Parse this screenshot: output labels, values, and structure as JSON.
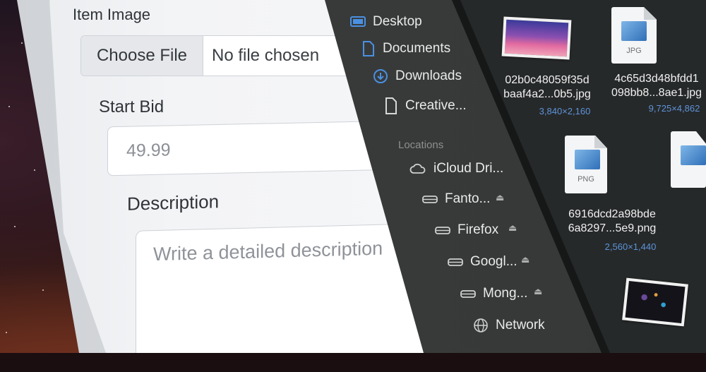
{
  "form": {
    "item_image_label": "Item Image",
    "choose_file_button": "Choose File",
    "file_status": "No file chosen",
    "start_bid_label": "Start Bid",
    "start_bid_placeholder": "49.99",
    "description_label": "Description",
    "description_placeholder": "Write a detailed description"
  },
  "finder": {
    "sidebar": {
      "favorites": [
        {
          "label": "Desktop",
          "icon": "desktop-icon"
        },
        {
          "label": "Documents",
          "icon": "document-icon"
        },
        {
          "label": "Downloads",
          "icon": "download-icon"
        },
        {
          "label": "Creative...",
          "icon": "file-icon"
        }
      ],
      "locations_heading": "Locations",
      "locations": [
        {
          "label": "iCloud Dri...",
          "icon": "cloud-icon",
          "ejectable": false
        },
        {
          "label": "Fanto...",
          "icon": "drive-icon",
          "ejectable": true
        },
        {
          "label": "Firefox",
          "icon": "drive-icon",
          "ejectable": true
        },
        {
          "label": "Googl...",
          "icon": "drive-icon",
          "ejectable": true
        },
        {
          "label": "Mong...",
          "icon": "drive-icon",
          "ejectable": true
        },
        {
          "label": "Network",
          "icon": "globe-icon",
          "ejectable": false
        }
      ]
    },
    "files": [
      {
        "name_line1": "02b0c48059f35d",
        "name_line2": "baaf4a2...0b5.jpg",
        "dimensions": "3,840×2,160"
      },
      {
        "name_line1": "4c65d3d48bfdd1",
        "name_line2": "098bb8...8ae1.jpg",
        "dimensions": "9,725×4,862",
        "type_label": "JPG"
      },
      {
        "name_line1": "6916dcd2a98bde",
        "name_line2": "6a8297...5e9.png",
        "dimensions": "2,560×1,440",
        "type_label": "PNG"
      }
    ]
  },
  "colors": {
    "form_background": "#f5f6f7",
    "sidebar_background": "#383a3a",
    "grid_background": "#26292a",
    "accent_blue": "#4a90e2",
    "dimension_text": "#5d93d8"
  }
}
